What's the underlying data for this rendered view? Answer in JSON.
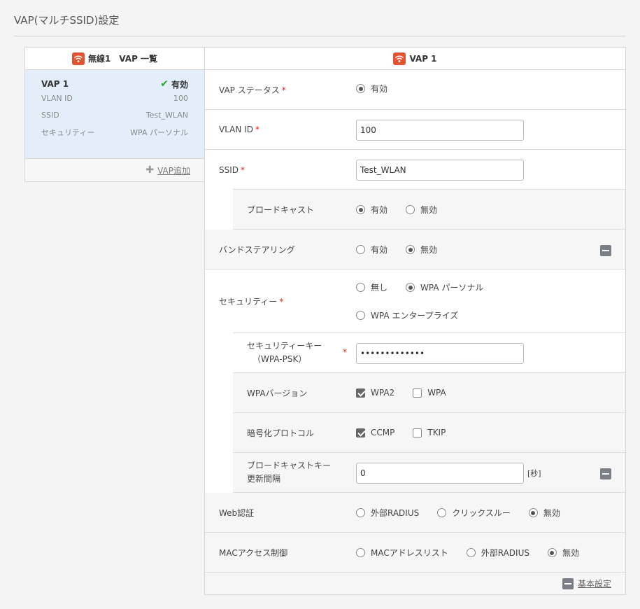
{
  "page": {
    "title": "VAP(マルチSSID)設定"
  },
  "left": {
    "header": "無線1　VAP 一覧",
    "card": {
      "name": "VAP 1",
      "status": "有効",
      "rows": [
        {
          "key": "VLAN ID",
          "value": "100"
        },
        {
          "key": "SSID",
          "value": "Test_WLAN"
        },
        {
          "key": "セキュリティー",
          "value": "WPA パーソナル"
        }
      ]
    },
    "add_label": "VAP追加"
  },
  "right": {
    "header": "VAP 1",
    "vap_status": {
      "label": "VAP ステータス",
      "option": "有効"
    },
    "vlan_id": {
      "label": "VLAN ID",
      "value": "100"
    },
    "ssid": {
      "label": "SSID",
      "value": "Test_WLAN"
    },
    "broadcast": {
      "label": "ブロードキャスト",
      "options": [
        "有効",
        "無効"
      ],
      "selected": "有効"
    },
    "band_steering": {
      "label": "バンドステアリング",
      "options": [
        "有効",
        "無効"
      ],
      "selected": "無効"
    },
    "security": {
      "label": "セキュリティー",
      "options": [
        "無し",
        "WPA パーソナル",
        "WPA エンタープライズ"
      ],
      "selected": "WPA パーソナル"
    },
    "security_key": {
      "label_line1": "セキュリティーキー",
      "label_line2": "（WPA-PSK）",
      "value": "•••••••••••••"
    },
    "wpa_version": {
      "label": "WPAバージョン",
      "options": [
        "WPA2",
        "WPA"
      ],
      "checked": [
        "WPA2"
      ]
    },
    "encryption": {
      "label": "暗号化プロトコル",
      "options": [
        "CCMP",
        "TKIP"
      ],
      "checked": [
        "CCMP"
      ]
    },
    "broadcast_key": {
      "label_line1": "ブロードキャストキー",
      "label_line2": "更新間隔",
      "value": "0",
      "unit": "[秒]"
    },
    "web_auth": {
      "label": "Web認証",
      "options": [
        "外部RADIUS",
        "クリックスルー",
        "無効"
      ],
      "selected": "無効"
    },
    "mac_access": {
      "label": "MACアクセス制御",
      "options": [
        "MACアドレスリスト",
        "外部RADIUS",
        "無効"
      ],
      "selected": "無効"
    },
    "basic_settings_label": "基本設定"
  },
  "colors": {
    "accent": "#e2532f",
    "card_bg": "#e3eefa",
    "check": "#2aa62a",
    "required": "#dd2222"
  }
}
